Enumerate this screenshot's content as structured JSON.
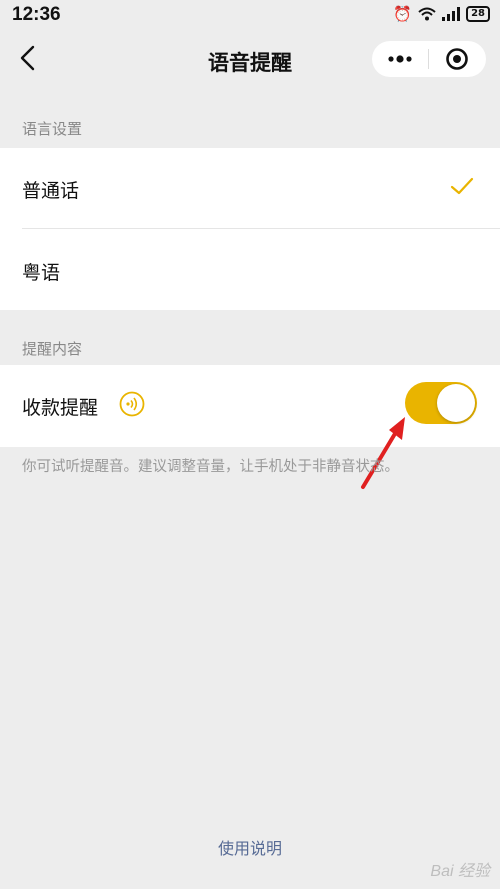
{
  "status_bar": {
    "time": "12:36",
    "battery": "28"
  },
  "nav": {
    "title": "语音提醒"
  },
  "language_section": {
    "label": "语言设置",
    "options": [
      {
        "label": "普通话",
        "selected": true
      },
      {
        "label": "粤语",
        "selected": false
      }
    ]
  },
  "reminder_section": {
    "label": "提醒内容",
    "payment_reminder": {
      "label": "收款提醒",
      "enabled": true
    },
    "hint": "你可试听提醒音。建议调整音量，让手机处于非静音状态。"
  },
  "footer": {
    "help_link": "使用说明"
  },
  "watermark": "Bai 经验",
  "colors": {
    "accent": "#e9b400",
    "link": "#576b95",
    "annotation_arrow": "#e02020"
  }
}
